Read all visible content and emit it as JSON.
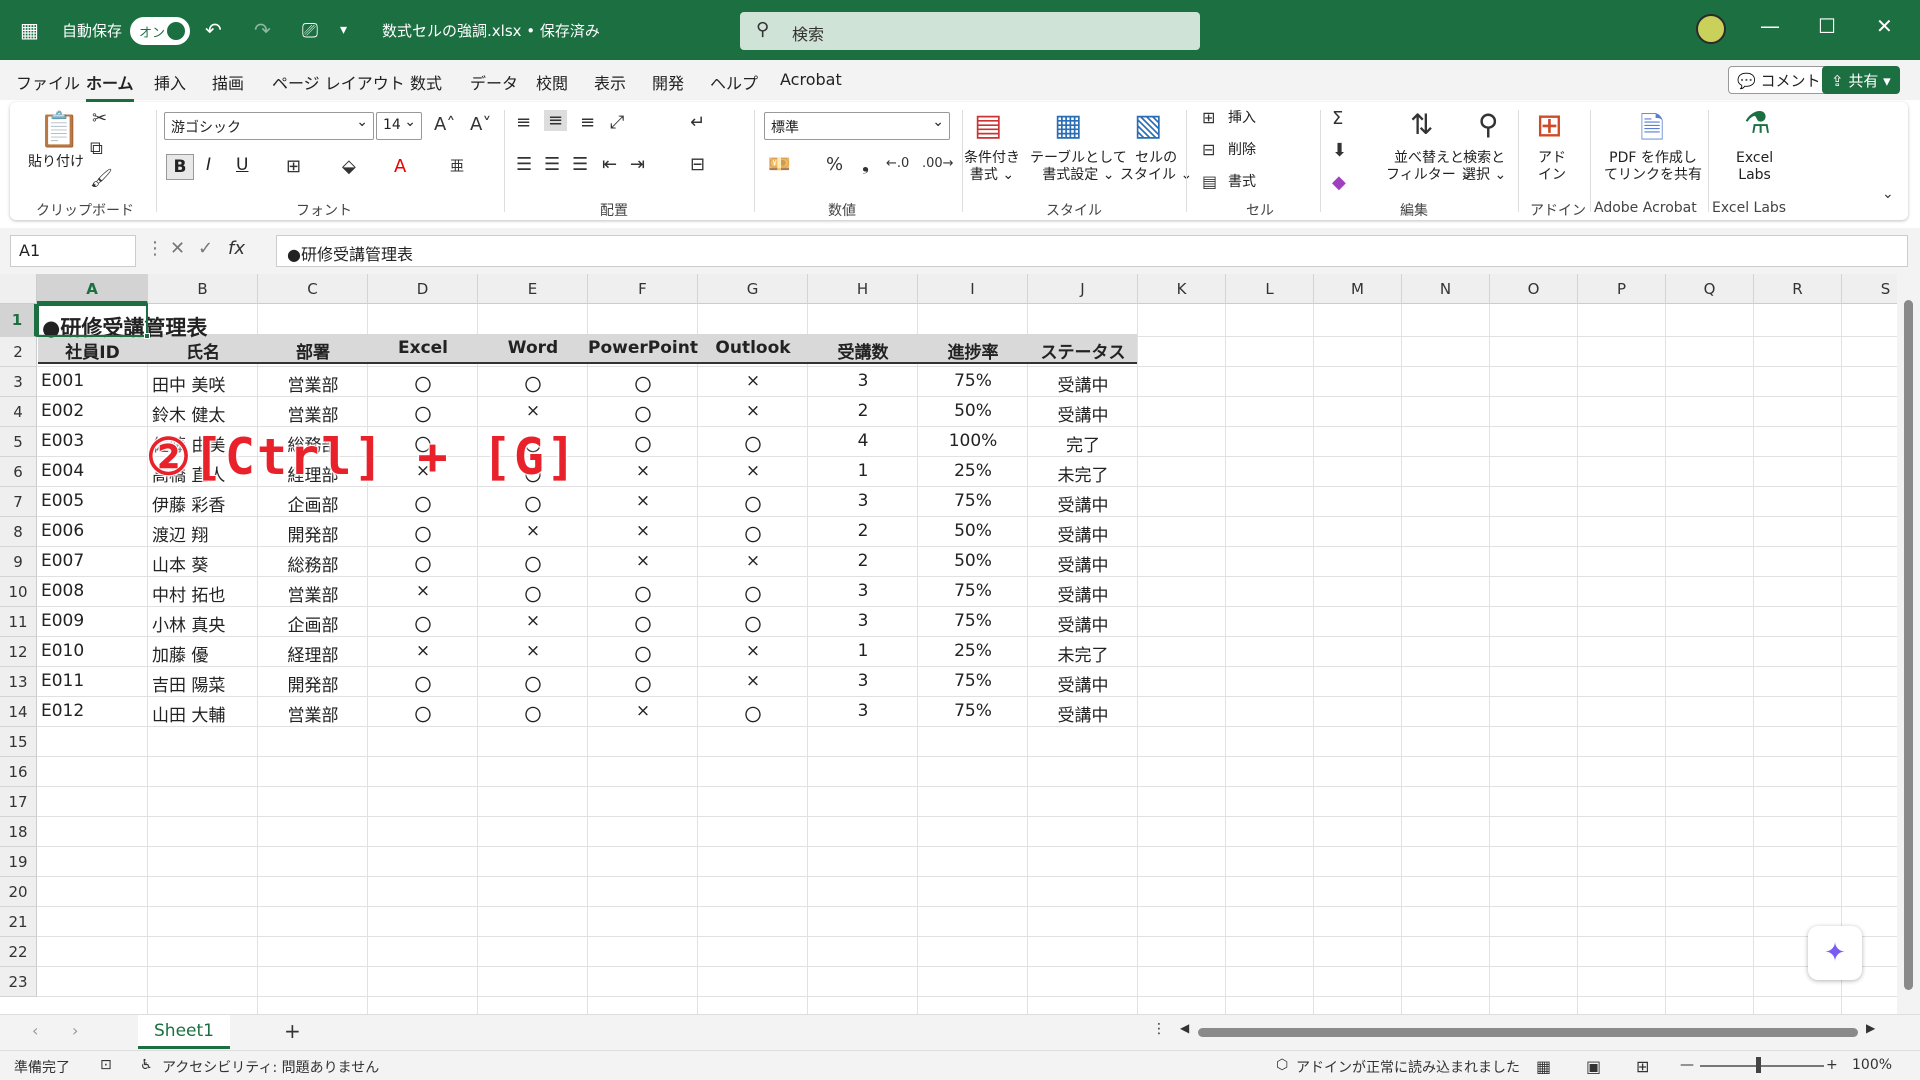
{
  "titlebar": {
    "autosave_label": "自動保存",
    "autosave_state": "オン",
    "filename": "数式セルの強調.xlsx • 保存済み",
    "search_placeholder": "検索"
  },
  "menu": [
    "ファイル",
    "ホーム",
    "挿入",
    "描画",
    "ページ レイアウト",
    "数式",
    "データ",
    "校閲",
    "表示",
    "開発",
    "ヘルプ",
    "Acrobat"
  ],
  "menu_active": "ホーム",
  "top_buttons": {
    "comment": "コメント",
    "share": "共有"
  },
  "ribbon": {
    "clipboard": {
      "label": "クリップボード",
      "paste": "貼り付け"
    },
    "font": {
      "label": "フォント",
      "name": "游ゴシック",
      "size": "14",
      "bold": "B",
      "italic": "I",
      "underline": "U"
    },
    "alignment": {
      "label": "配置"
    },
    "number": {
      "label": "数値",
      "format": "標準"
    },
    "styles": {
      "label": "スタイル",
      "conditional": "条件付き\n書式",
      "table": "テーブルとして\n書式設定",
      "cell": "セルの\nスタイル"
    },
    "cells": {
      "label": "セル",
      "insert": "挿入",
      "delete": "削除",
      "format": "書式"
    },
    "editing": {
      "label": "編集",
      "sort": "並べ替えと\nフィルター",
      "find": "検索と\n選択"
    },
    "addins": {
      "label": "アドイン",
      "button": "アド\nイン"
    },
    "acrobat": {
      "label": "Adobe Acrobat",
      "button": "PDF を作成し\nてリンクを共有"
    },
    "labs": {
      "label": "Excel Labs",
      "button": "Excel\nLabs"
    }
  },
  "formula_bar": {
    "name_box": "A1",
    "content": "●研修受講管理表"
  },
  "columns": [
    "A",
    "B",
    "C",
    "D",
    "E",
    "F",
    "G",
    "H",
    "I",
    "J",
    "K",
    "L",
    "M",
    "N",
    "O",
    "P",
    "Q",
    "R",
    "S"
  ],
  "rows": [
    "1",
    "2",
    "3",
    "4",
    "5",
    "6",
    "7",
    "8",
    "9",
    "10",
    "11",
    "12",
    "13",
    "14",
    "15",
    "16",
    "17",
    "18",
    "19",
    "20",
    "21",
    "22",
    "23"
  ],
  "sheet": {
    "title": "●研修受講管理表",
    "headers": [
      "社員ID",
      "氏名",
      "部署",
      "Excel",
      "Word",
      "PowerPoint",
      "Outlook",
      "受講数",
      "進捗率",
      "ステータス"
    ],
    "data": [
      [
        "E001",
        "田中 美咲",
        "営業部",
        "〇",
        "〇",
        "〇",
        "×",
        "3",
        "75%",
        "受講中"
      ],
      [
        "E002",
        "鈴木 健太",
        "営業部",
        "〇",
        "×",
        "〇",
        "×",
        "2",
        "50%",
        "受講中"
      ],
      [
        "E003",
        "佐藤 由美",
        "総務部",
        "〇",
        "〇",
        "〇",
        "〇",
        "4",
        "100%",
        "完了"
      ],
      [
        "E004",
        "高橋 直人",
        "経理部",
        "×",
        "〇",
        "×",
        "×",
        "1",
        "25%",
        "未完了"
      ],
      [
        "E005",
        "伊藤 彩香",
        "企画部",
        "〇",
        "〇",
        "×",
        "〇",
        "3",
        "75%",
        "受講中"
      ],
      [
        "E006",
        "渡辺 翔",
        "開発部",
        "〇",
        "×",
        "×",
        "〇",
        "2",
        "50%",
        "受講中"
      ],
      [
        "E007",
        "山本 葵",
        "総務部",
        "〇",
        "〇",
        "×",
        "×",
        "2",
        "50%",
        "受講中"
      ],
      [
        "E008",
        "中村 拓也",
        "営業部",
        "×",
        "〇",
        "〇",
        "〇",
        "3",
        "75%",
        "受講中"
      ],
      [
        "E009",
        "小林 真央",
        "企画部",
        "〇",
        "×",
        "〇",
        "〇",
        "3",
        "75%",
        "受講中"
      ],
      [
        "E010",
        "加藤 優",
        "経理部",
        "×",
        "×",
        "〇",
        "×",
        "1",
        "25%",
        "未完了"
      ],
      [
        "E011",
        "吉田 陽菜",
        "開発部",
        "〇",
        "〇",
        "〇",
        "×",
        "3",
        "75%",
        "受講中"
      ],
      [
        "E012",
        "山田 大輔",
        "営業部",
        "〇",
        "〇",
        "×",
        "〇",
        "3",
        "75%",
        "受講中"
      ]
    ]
  },
  "overlay_text": "②[Ctrl] + [G]",
  "sheet_tab": "Sheet1",
  "status": {
    "ready": "準備完了",
    "accessibility": "アクセシビリティ: 問題ありません",
    "addin_msg": "アドインが正常に読み込まれました",
    "zoom": "100%"
  },
  "colors": {
    "accent": "#1b6f40",
    "overlay": "#e8212b"
  }
}
